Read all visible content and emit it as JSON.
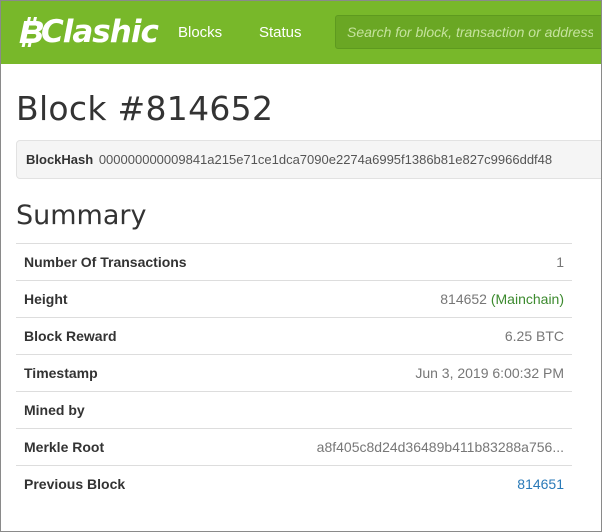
{
  "brand": {
    "name": "Clashic"
  },
  "nav": {
    "blocks": "Blocks",
    "status": "Status"
  },
  "search": {
    "placeholder": "Search for block, transaction or address"
  },
  "page": {
    "title": "Block #814652",
    "blockhash_label": "BlockHash",
    "blockhash_value": "000000000009841a215e71ce1dca7090e2274a6995f1386b81e827c9966ddf48"
  },
  "summary": {
    "title": "Summary",
    "rows": [
      {
        "label": "Number Of Transactions",
        "value": "1"
      },
      {
        "label": "Height",
        "value": "814652",
        "note": "(Mainchain)"
      },
      {
        "label": "Block Reward",
        "value": "6.25 BTC"
      },
      {
        "label": "Timestamp",
        "value": "Jun 3, 2019 6:00:32 PM"
      },
      {
        "label": "Mined by",
        "value": ""
      },
      {
        "label": "Merkle Root",
        "value": "a8f405c8d24d36489b411b83288a756..."
      },
      {
        "label": "Previous Block",
        "value": "814651"
      }
    ]
  },
  "colors": {
    "accent": "#78b82a",
    "link": "#2a7ab8",
    "mainchain": "#3c8a2e"
  }
}
